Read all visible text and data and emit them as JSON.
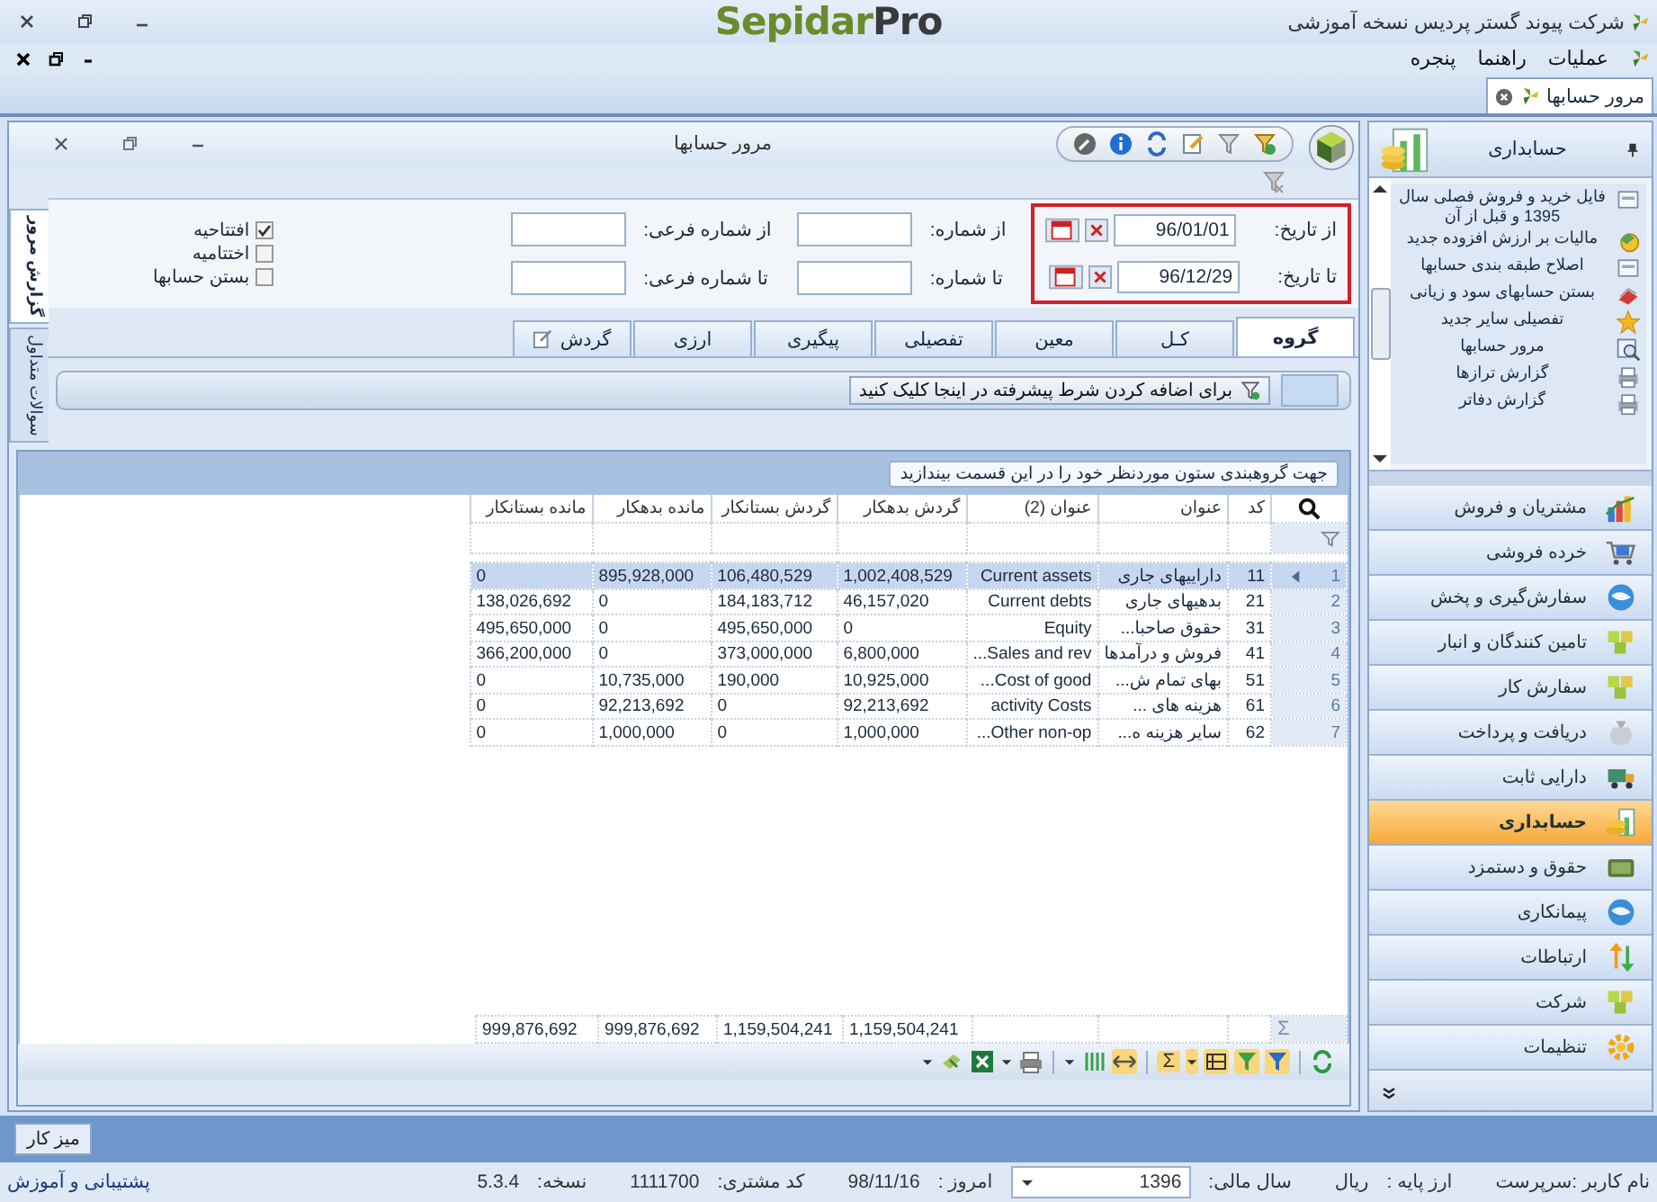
{
  "app": {
    "title": "شرکت پیوند گستر پردیس نسخه آموزشی",
    "logo": "Sepidar**Pro**"
  },
  "menu": [
    {
      "label": "عملیات"
    },
    {
      "label": "راهنما"
    },
    {
      "label": "پنجره"
    }
  ],
  "doc_tabs": [
    {
      "label": "مرور حسابها",
      "selected": true
    }
  ],
  "child_window": {
    "title": "مرور حسابها"
  },
  "side_tabs": [
    {
      "label": "گزارش مرور",
      "selected": true
    },
    {
      "label": "سوالات متداول",
      "selected": false
    }
  ],
  "date_fields": [
    {
      "label": "از تاریخ:",
      "value": "96/01/01"
    },
    {
      "label": "تا تاریخ:",
      "value": "96/12/29"
    }
  ],
  "number_fields": [
    {
      "label": "از شماره:"
    },
    {
      "label": "تا شماره:"
    }
  ],
  "sub_number_fields": [
    {
      "label": "از شماره فرعی:"
    },
    {
      "label": "تا شماره فرعی:"
    }
  ],
  "options": [
    {
      "label": "افتتاحیه",
      "checked": true
    },
    {
      "label": "اختتامیه",
      "checked": false
    },
    {
      "label": "بستن حسابها",
      "checked": false
    }
  ],
  "tabs": [
    {
      "label": "گروه",
      "selected": true,
      "kind": "text"
    },
    {
      "label": "کـل",
      "selected": false,
      "kind": "text"
    },
    {
      "label": "معین",
      "selected": false,
      "kind": "text"
    },
    {
      "label": "تفصیلی",
      "selected": false,
      "kind": "text"
    },
    {
      "label": "پیگیری",
      "selected": false,
      "kind": "text"
    },
    {
      "label": "ارزی",
      "selected": false,
      "kind": "text"
    },
    {
      "label": "گردش",
      "selected": false,
      "kind": "icon"
    }
  ],
  "filter_bar": {
    "text": "برای اضافه کردن شرط پیشرفته در اینجا کلیک کنید"
  },
  "group_panel": {
    "text": "جهت گروهبندی ستون موردنظر خود را در این قسمت بیندازید"
  },
  "table": {
    "columns": [
      "کد",
      "عنوان",
      "عنوان (2)",
      "گردش بدهکار",
      "گردش بستانکار",
      "مانده بدهکار",
      "مانده بستانکار"
    ],
    "rows": [
      {
        "number": "1",
        "selected": true,
        "cells": [
          "11",
          "دارایيهای جاری",
          "Current assets",
          "1,002,408,529",
          "106,480,529",
          "895,928,000",
          "0"
        ]
      },
      {
        "number": "2",
        "selected": false,
        "cells": [
          "21",
          "بدهیهای جاری",
          "Current debts",
          "46,157,020",
          "184,183,712",
          "0",
          "138,026,692"
        ]
      },
      {
        "number": "3",
        "selected": false,
        "cells": [
          "31",
          "حقوق صاحبا...",
          "Equity",
          "0",
          "495,650,000",
          "0",
          "495,650,000"
        ]
      },
      {
        "number": "4",
        "selected": false,
        "cells": [
          "41",
          "فروش و درآمدها",
          "Sales and rev...",
          "6,800,000",
          "373,000,000",
          "0",
          "366,200,000"
        ]
      },
      {
        "number": "5",
        "selected": false,
        "cells": [
          "51",
          "بهای تمام ش...",
          "Cost of good...",
          "10,925,000",
          "190,000",
          "10,735,000",
          "0"
        ]
      },
      {
        "number": "6",
        "selected": false,
        "cells": [
          "61",
          "هزینه های ...",
          "activity Costs",
          "92,213,692",
          "0",
          "92,213,692",
          "0"
        ]
      },
      {
        "number": "7",
        "selected": false,
        "cells": [
          "62",
          "سایر هزینه ه...",
          "Other non-op...",
          "1,000,000",
          "0",
          "1,000,000",
          "0"
        ]
      }
    ],
    "footer_mark": "Σ",
    "totals": [
      "1,159,504,241",
      "1,159,504,241",
      "999,876,692",
      "999,876,692"
    ]
  },
  "toolbar": {
    "sum_symbol": "Σ"
  },
  "sidebar": {
    "header": "حسابداری",
    "items": [
      "فایل خرید و فروش فصلی سال 1395 و قبل از آن",
      "مالیات بر ارزش افزوده جدید",
      "اصلاح طبقه بندی حسابها",
      "بستن حسابهای سود و زیانی",
      "تفصیلی سایر جدید",
      "مرور حسابها",
      "گزارش ترازها",
      "گزارش دفاتر"
    ],
    "nav": [
      {
        "label": "مشتریان و فروش",
        "selected": false
      },
      {
        "label": "خرده فروشی",
        "selected": false
      },
      {
        "label": "سفارش‌گیری و پخش",
        "selected": false
      },
      {
        "label": "تامین کنندگان و انبار",
        "selected": false
      },
      {
        "label": "سفارش کار",
        "selected": false
      },
      {
        "label": "دریافت و پرداخت",
        "selected": false
      },
      {
        "label": "دارایی ثابت",
        "selected": false
      },
      {
        "label": "حسابداری",
        "selected": true
      },
      {
        "label": "حقوق و دستمزد",
        "selected": false
      },
      {
        "label": "پیمانکاری",
        "selected": false
      },
      {
        "label": "ارتباطات",
        "selected": false
      },
      {
        "label": "شرکت",
        "selected": false
      },
      {
        "label": "تنظیمات",
        "selected": false
      }
    ]
  },
  "taskbar": {
    "button": "میز کار"
  },
  "status_bar": {
    "user": "نام کاربر :سرپرست",
    "currency_label": "ارز پایه :",
    "currency": "ریال",
    "year_label": "سال مالی:",
    "year": "1396",
    "today_label": "امروز :",
    "today": "98/11/16",
    "customer_label": "کد مشتری:",
    "customer": "1111700",
    "version_label": "نسخه:",
    "version": "5.3.4",
    "support_link": "پشتیبانی و آموزش"
  }
}
